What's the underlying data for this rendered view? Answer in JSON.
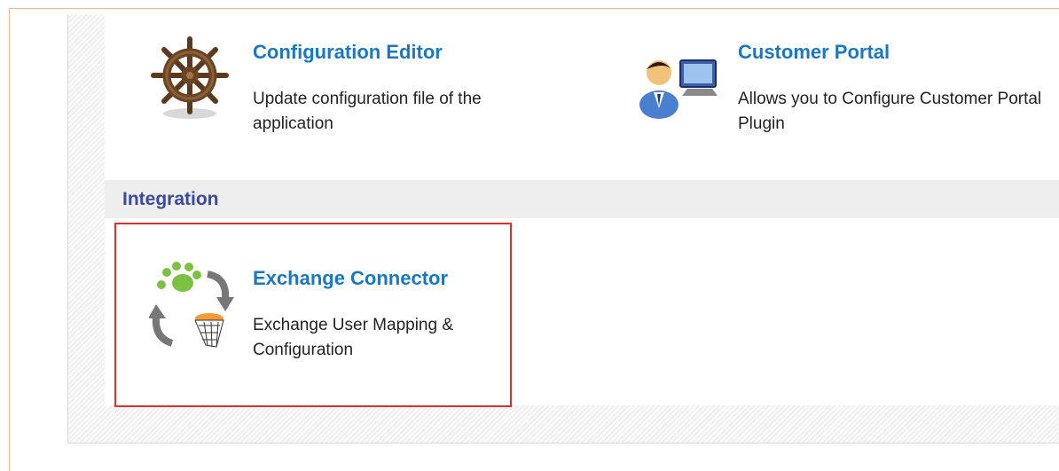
{
  "tiles": {
    "config_editor": {
      "title": "Configuration Editor",
      "description": "Update configuration file of the application",
      "icon": "ship-wheel-icon"
    },
    "customer_portal": {
      "title": "Customer Portal",
      "description": "Allows you to Configure Customer Portal Plugin",
      "icon": "user-computer-icon"
    },
    "exchange_connector": {
      "title": "Exchange Connector",
      "description": "Exchange User Mapping & Configuration",
      "icon": "exchange-sync-icon"
    }
  },
  "section": {
    "title": "Integration"
  },
  "colors": {
    "link": "#1a78c2",
    "section_title": "#3a4aa0",
    "selection_border": "#d9312d",
    "section_bar": "#eeeeee"
  }
}
